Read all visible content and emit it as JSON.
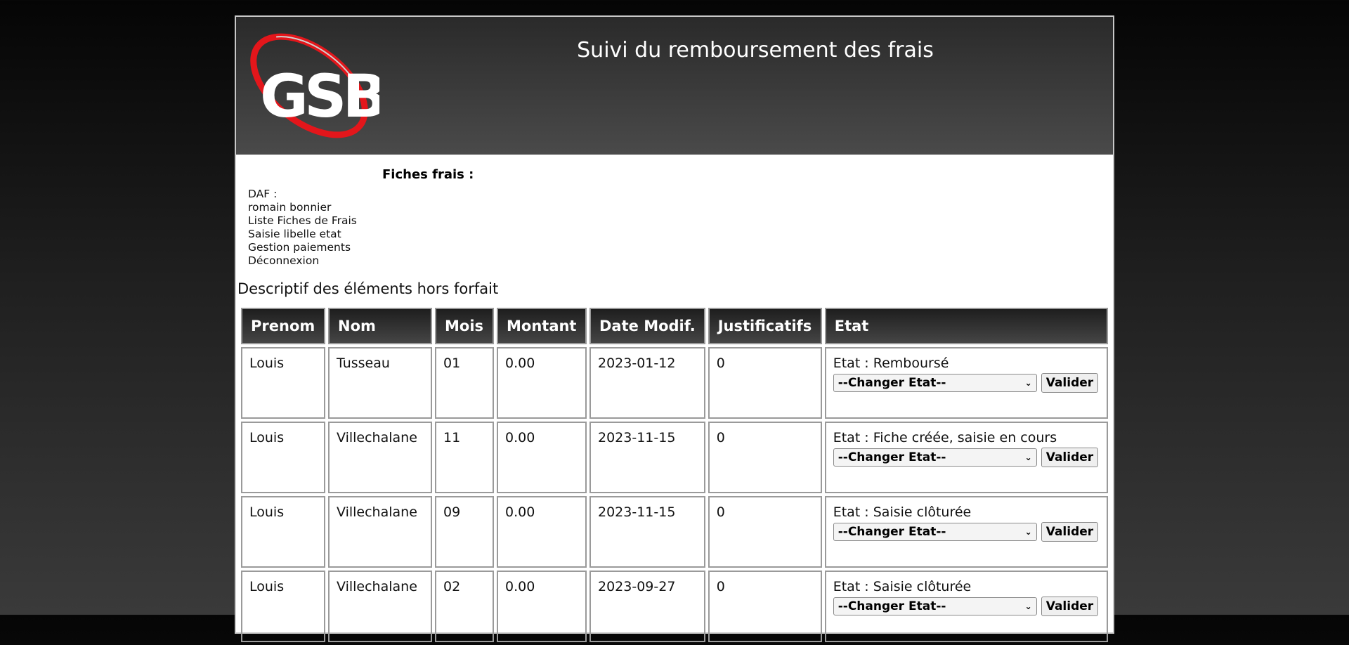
{
  "header": {
    "title": "Suivi du remboursement des frais",
    "logo_text": "GSB"
  },
  "section_title": "Fiches frais :",
  "sidebar": {
    "role": "DAF :",
    "user": "romain bonnier",
    "links": [
      "Liste Fiches de Frais",
      "Saisie libelle etat",
      "Gestion paiements",
      "Déconnexion"
    ]
  },
  "description": "Descriptif des éléments hors forfait",
  "table": {
    "columns": [
      "Prenom",
      "Nom",
      "Mois",
      "Montant",
      "Date Modif.",
      "Justificatifs",
      "Etat"
    ],
    "rows": [
      {
        "prenom": "Louis",
        "nom": "Tusseau",
        "mois": "01",
        "montant": "0.00",
        "date": "2023-01-12",
        "justificatifs": "0",
        "etat": "Etat : Remboursé"
      },
      {
        "prenom": "Louis",
        "nom": "Villechalane",
        "mois": "11",
        "montant": "0.00",
        "date": "2023-11-15",
        "justificatifs": "0",
        "etat": "Etat : Fiche créée, saisie en cours"
      },
      {
        "prenom": "Louis",
        "nom": "Villechalane",
        "mois": "09",
        "montant": "0.00",
        "date": "2023-11-15",
        "justificatifs": "0",
        "etat": "Etat : Saisie clôturée"
      },
      {
        "prenom": "Louis",
        "nom": "Villechalane",
        "mois": "02",
        "montant": "0.00",
        "date": "2023-09-27",
        "justificatifs": "0",
        "etat": "Etat : Saisie clôturée"
      }
    ],
    "select_label": "--Changer Etat--",
    "validate_label": "Valider"
  },
  "colors": {
    "header_bg": "#3a3a3a",
    "logo_red": "#e3161b",
    "page_bg": "#ffffff"
  }
}
